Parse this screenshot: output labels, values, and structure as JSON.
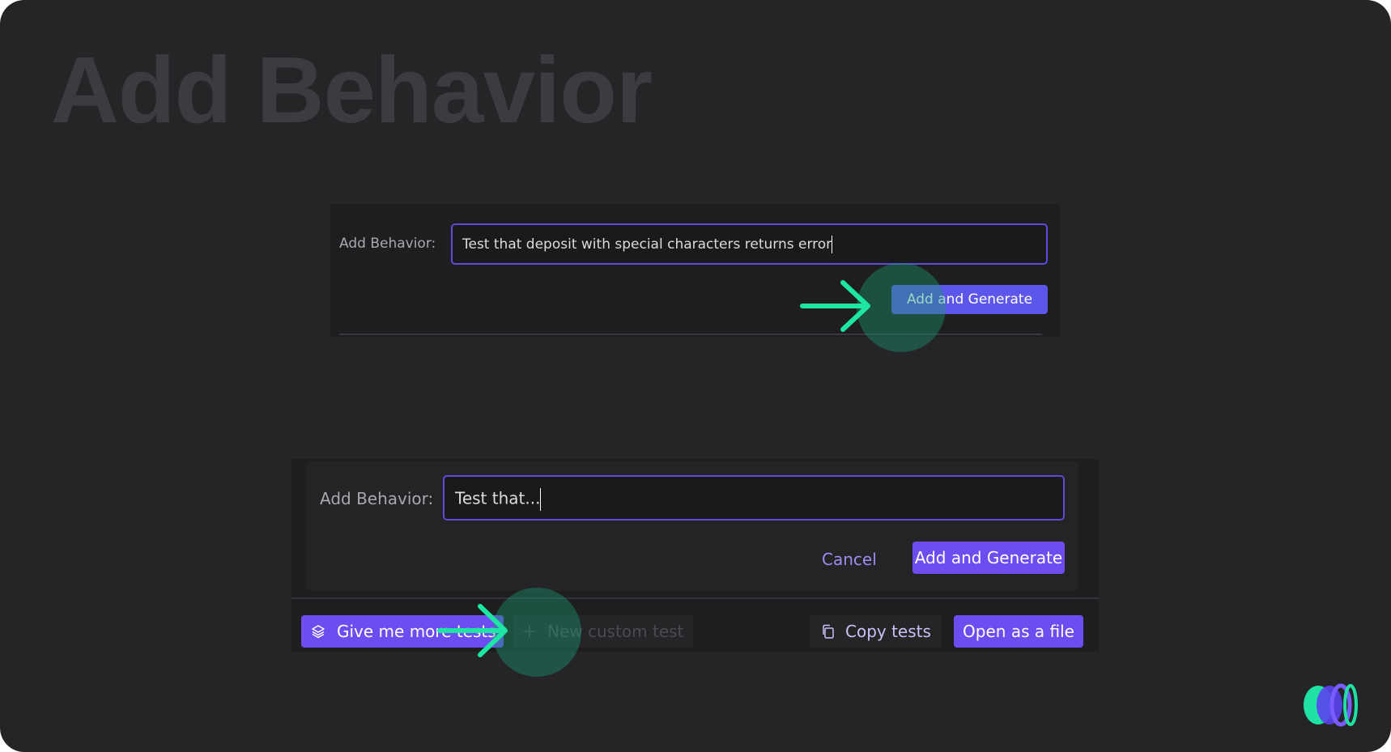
{
  "hero": {
    "title": "Add Behavior"
  },
  "panel_top": {
    "label": "Add Behavior:",
    "input_value": "Test that deposit with special characters returns error",
    "generate_button": "Add and Generate"
  },
  "panel_bottom": {
    "label": "Add Behavior:",
    "input_value": "Test that...",
    "cancel_button": "Cancel",
    "generate_button": "Add and Generate",
    "toolbar": {
      "more_tests": "Give me more tests",
      "new_custom_test": "New custom test",
      "copy_tests": "Copy tests",
      "open_file": "Open as a file"
    }
  },
  "icons": {
    "arrow": "arrow-right-icon",
    "layers": "layers-icon",
    "plus": "plus-icon",
    "copy": "copy-icon",
    "logo": "brand-logo"
  },
  "colors": {
    "background": "#252528",
    "panel": "#1e1e20",
    "accent": "#6d4cf0",
    "arrow": "#1de5a4",
    "highlight": "#1a9670"
  }
}
